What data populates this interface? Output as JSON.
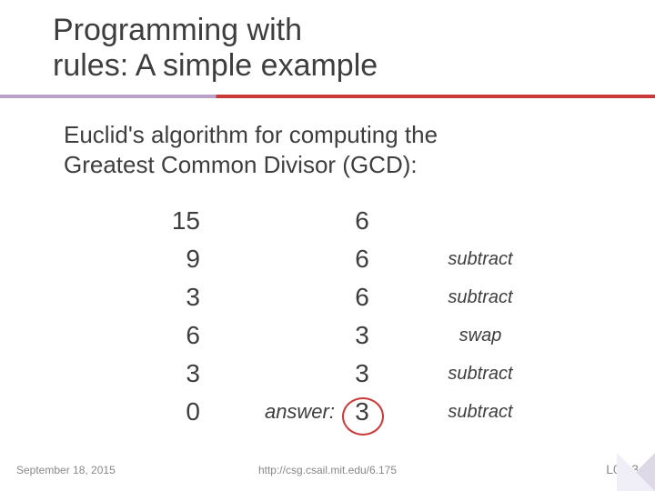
{
  "title_line1": "Programming with",
  "title_line2": "rules: A simple example",
  "subtitle_line1": "Euclid's algorithm for computing the",
  "subtitle_line2": "Greatest Common Divisor (GCD):",
  "rows": [
    {
      "a": "15",
      "b": "6",
      "op": "",
      "ans": ""
    },
    {
      "a": "9",
      "b": "6",
      "op": "subtract",
      "ans": ""
    },
    {
      "a": "3",
      "b": "6",
      "op": "subtract",
      "ans": ""
    },
    {
      "a": "6",
      "b": "3",
      "op": "swap",
      "ans": ""
    },
    {
      "a": "3",
      "b": "3",
      "op": "subtract",
      "ans": ""
    },
    {
      "a": "0",
      "b": "3",
      "op": "subtract",
      "ans": "answer:"
    }
  ],
  "footer": {
    "date": "September 18, 2015",
    "url": "http://csg.csail.mit.edu/6.175",
    "page": "L05-3"
  }
}
